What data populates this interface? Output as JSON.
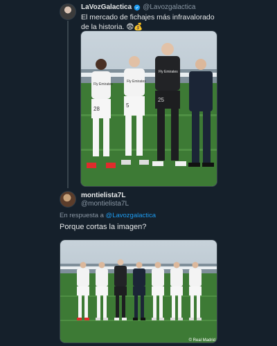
{
  "tweet1": {
    "display_name": "LaVozGalactica",
    "handle": "@Lavozgalactica",
    "text": "El mercado de fichajes más infravalorado de la historia. 😨💰",
    "image_1": {
      "players": [
        {
          "kit": "white",
          "number": "28"
        },
        {
          "kit": "white",
          "number": "5"
        },
        {
          "kit": "goalkeeper",
          "number": "25"
        },
        {
          "kit": "suit",
          "number": ""
        }
      ],
      "sponsor_text": "Fly Emirates"
    }
  },
  "tweet2": {
    "display_name": "montielista7L",
    "handle": "@montielista7L",
    "reply_prefix": "En respuesta a ",
    "reply_mention": "@Lavozgalactica",
    "text": "Porque cortas la imagen?",
    "image_2": {
      "watermark": "© Real Madrid",
      "people": [
        "white",
        "white",
        "goalkeeper",
        "suit",
        "white",
        "white",
        "white"
      ]
    }
  },
  "colors": {
    "background": "#15202b",
    "text": "#e7e9ea",
    "secondary": "#8b98a5",
    "link": "#1d9bf0",
    "verified": "#1d9bf0",
    "divider": "#38444d"
  }
}
